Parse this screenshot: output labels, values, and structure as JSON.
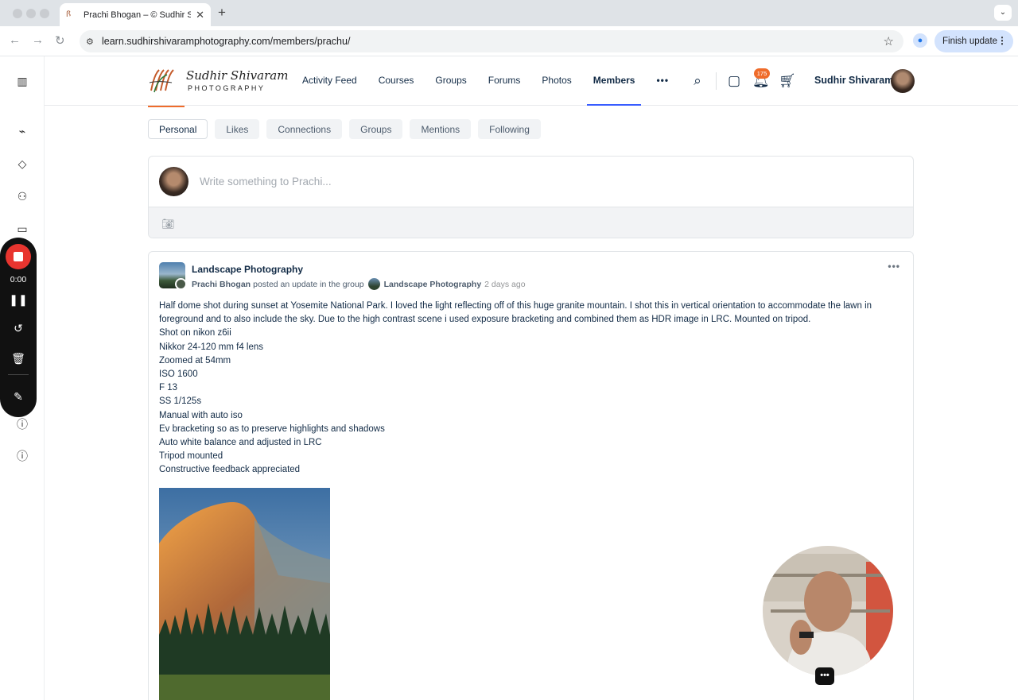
{
  "browser": {
    "tab_title": "Prachi Bhogan – © Sudhir Sh",
    "url": "learn.sudhirshivaramphotography.com/members/prachu/",
    "finish_update_label": "Finish update"
  },
  "recorder": {
    "time": "0:00"
  },
  "site": {
    "logo_script": "Sudhir Shivaram",
    "logo_sub": "PHOTOGRAPHY",
    "nav": [
      {
        "label": "Activity Feed"
      },
      {
        "label": "Courses"
      },
      {
        "label": "Groups"
      },
      {
        "label": "Forums"
      },
      {
        "label": "Photos"
      },
      {
        "label": "Members"
      }
    ],
    "notification_count": "175",
    "user_name": "Sudhir Shivaram"
  },
  "subtabs": [
    "Personal",
    "Likes",
    "Connections",
    "Groups",
    "Mentions",
    "Following"
  ],
  "composer": {
    "placeholder": "Write something to Prachi..."
  },
  "post": {
    "group_title": "Landscape Photography",
    "author": "Prachi Bhogan",
    "action": "posted an update in the group",
    "group_name": "Landscape Photography",
    "time_ago": "2 days ago",
    "body": [
      "Half dome shot during sunset at Yosemite National Park. I loved the light reflecting off of this huge granite mountain. I shot this in vertical orientation to accommodate the lawn in foreground and to also include the sky. Due to the high contrast scene i used exposure bracketing and combined them as HDR image in LRC. Mounted on tripod.",
      "Shot on nikon z6ii",
      "Nikkor 24-120 mm f4 lens",
      "Zoomed at 54mm",
      "ISO 1600",
      "F 13",
      "SS 1/125s",
      "Manual with auto iso",
      "Ev bracketing so as to preserve highlights and shadows",
      "Auto white balance and adjusted in LRC",
      "Tripod mounted",
      "Constructive feedback appreciated"
    ]
  },
  "colors": {
    "accent": "#385dff",
    "badge": "#ef6c2b",
    "record": "#e8352f"
  }
}
